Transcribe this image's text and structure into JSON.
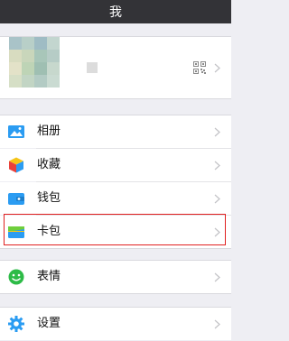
{
  "header": {
    "title": "我"
  },
  "profile": {
    "avatar_colors": [
      "#a9c3c8",
      "#b8cfc8",
      "#9fbcc4",
      "#c3d6cf",
      "#d8dcc0",
      "#c9d6bb",
      "#a8c6b9",
      "#b6ccc6",
      "#e3e2c8",
      "#bed4b6",
      "#9fbfb2",
      "#c7d8cd",
      "#d6dfc6",
      "#c2d5c4",
      "#b3cbc4",
      "#cadbd2"
    ],
    "qr_icon": "qr-code-icon"
  },
  "menu": {
    "album": {
      "label": "相册",
      "icon": "photo-album-icon",
      "color": "#2b9cf2"
    },
    "favorites": {
      "label": "收藏",
      "icon": "favorites-cube-icon"
    },
    "wallet": {
      "label": "钱包",
      "icon": "wallet-icon",
      "color": "#2b9cf2"
    },
    "cards": {
      "label": "卡包",
      "icon": "card-wallet-icon"
    },
    "emoji": {
      "label": "表情",
      "icon": "smiley-face-icon",
      "color": "#2dbb47"
    },
    "settings": {
      "label": "设置",
      "icon": "gear-icon",
      "color": "#2b9cf2"
    }
  },
  "highlight": {
    "color": "#e02020",
    "target": "卡包"
  }
}
